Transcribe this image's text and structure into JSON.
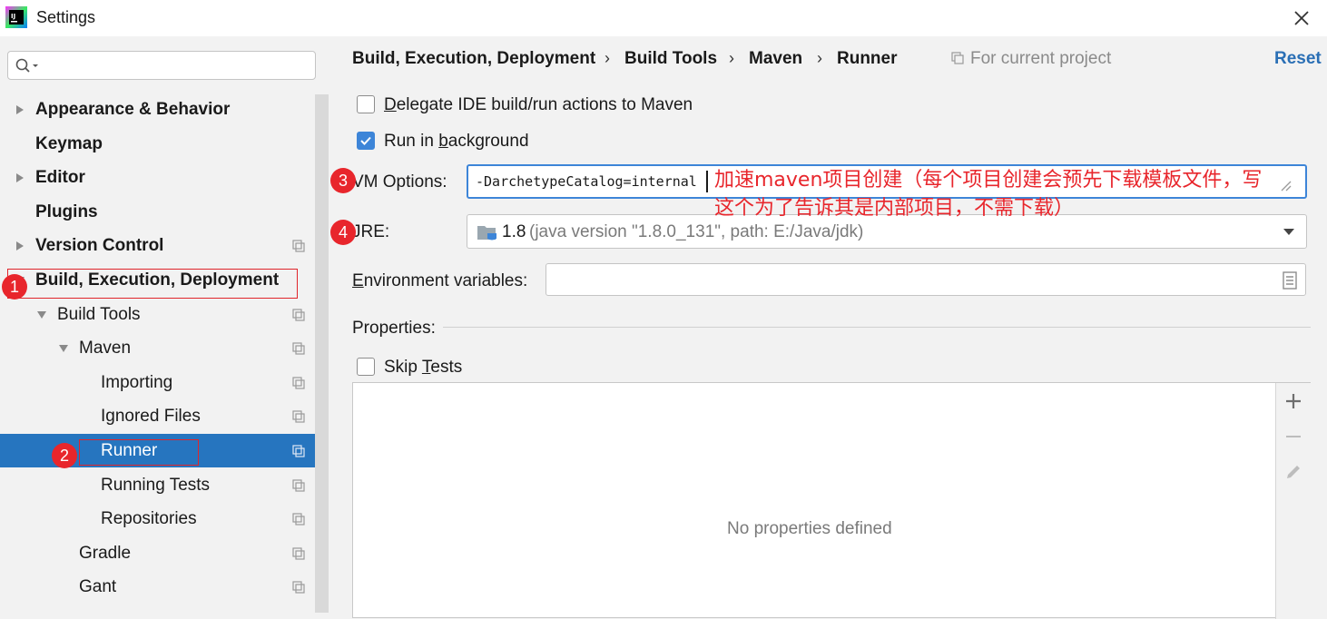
{
  "window": {
    "title": "Settings",
    "icon": "intellij-idea-icon",
    "close_icon": "close-icon"
  },
  "sidebar": {
    "search_placeholder": "",
    "tree": [
      {
        "label": "Appearance & Behavior",
        "level": 0,
        "expandable": true,
        "expanded": false,
        "bold": true,
        "project_scoped": false
      },
      {
        "label": "Keymap",
        "level": 0,
        "expandable": false,
        "bold": true,
        "project_scoped": false
      },
      {
        "label": "Editor",
        "level": 0,
        "expandable": true,
        "expanded": false,
        "bold": true,
        "project_scoped": false
      },
      {
        "label": "Plugins",
        "level": 0,
        "expandable": false,
        "bold": true,
        "project_scoped": false
      },
      {
        "label": "Version Control",
        "level": 0,
        "expandable": true,
        "expanded": false,
        "bold": true,
        "project_scoped": true
      },
      {
        "label": "Build, Execution, Deployment",
        "level": 0,
        "expandable": true,
        "expanded": true,
        "bold": true,
        "project_scoped": false
      },
      {
        "label": "Build Tools",
        "level": 1,
        "expandable": true,
        "expanded": true,
        "bold": false,
        "project_scoped": true
      },
      {
        "label": "Maven",
        "level": 2,
        "expandable": true,
        "expanded": true,
        "bold": false,
        "project_scoped": true
      },
      {
        "label": "Importing",
        "level": 3,
        "expandable": false,
        "bold": false,
        "project_scoped": true
      },
      {
        "label": "Ignored Files",
        "level": 3,
        "expandable": false,
        "bold": false,
        "project_scoped": true
      },
      {
        "label": "Runner",
        "level": 3,
        "expandable": false,
        "bold": false,
        "project_scoped": true,
        "selected": true
      },
      {
        "label": "Running Tests",
        "level": 3,
        "expandable": false,
        "bold": false,
        "project_scoped": true
      },
      {
        "label": "Repositories",
        "level": 3,
        "expandable": false,
        "bold": false,
        "project_scoped": true
      },
      {
        "label": "Gradle",
        "level": 2,
        "expandable": false,
        "bold": false,
        "project_scoped": true
      },
      {
        "label": "Gant",
        "level": 2,
        "expandable": false,
        "bold": false,
        "project_scoped": true
      }
    ]
  },
  "breadcrumb": {
    "items": [
      "Build, Execution, Deployment",
      "Build Tools",
      "Maven",
      "Runner"
    ],
    "separator": "›",
    "scope": "For current project",
    "reset": "Reset"
  },
  "runner": {
    "delegate_label": "Delegate IDE build/run actions to Maven",
    "delegate_checked": false,
    "background_label": "Run in background",
    "background_checked": true,
    "vm_options_label": "VM Options:",
    "vm_options_value": "-DarchetypeCatalog=internal",
    "jre_label": "JRE:",
    "jre_version": "1.8",
    "jre_detail": "(java version \"1.8.0_131\", path: E:/Java/jdk)",
    "env_label": "Environment variables:",
    "env_value": "",
    "properties_label": "Properties:",
    "skip_tests_label": "Skip Tests",
    "skip_tests_checked": false,
    "properties_empty": "No properties defined"
  },
  "annotations": {
    "badges": [
      "1",
      "2",
      "3",
      "4"
    ],
    "note_line1": "加速maven项目创建（每个项目创建会预先下载模板文件，写",
    "note_line2": "这个为了告诉其是内部项目，不需下载）",
    "color": "#e8262c"
  },
  "colors": {
    "selection": "#2675bf",
    "accent": "#3d85d8",
    "link": "#2a6fb5"
  }
}
